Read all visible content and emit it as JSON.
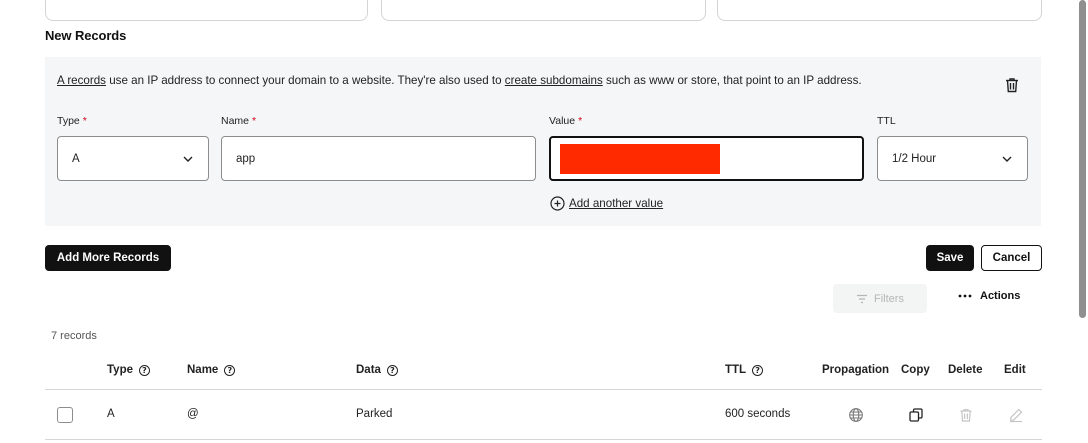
{
  "section_title": "New Records",
  "info": {
    "link_a_records": "A records",
    "text_1": " use an IP address to connect your domain to a website. They're also used to ",
    "link_subdomains": "create subdomains",
    "text_2": " such as www or store, that point to an IP address."
  },
  "form": {
    "type_label": "Type",
    "type_value": "A",
    "name_label": "Name",
    "name_value": "app",
    "value_label": "Value",
    "value_value": "",
    "ttl_label": "TTL",
    "ttl_value": "1/2 Hour",
    "required_mark": "*",
    "add_value_label": "Add another value"
  },
  "buttons": {
    "add_more": "Add More Records",
    "save": "Save",
    "cancel": "Cancel",
    "filters": "Filters",
    "actions": "Actions"
  },
  "record_count": "7 records",
  "table": {
    "headers": {
      "type": "Type",
      "name": "Name",
      "data": "Data",
      "ttl": "TTL",
      "propagation": "Propagation",
      "copy": "Copy",
      "delete": "Delete",
      "edit": "Edit"
    },
    "rows": [
      {
        "type": "A",
        "name": "@",
        "data": "Parked",
        "ttl": "600 seconds"
      }
    ]
  },
  "colors": {
    "accent_dark": "#111111",
    "required": "#d0021b",
    "redaction": "#ff2a00",
    "panel_bg": "#f5f6f7"
  },
  "icons": [
    "trash-icon",
    "chevron-down-icon",
    "plus-circle-icon",
    "filter-icon",
    "more-dots-icon",
    "help-icon",
    "globe-icon",
    "copy-icon",
    "edit-pencil-icon"
  ]
}
